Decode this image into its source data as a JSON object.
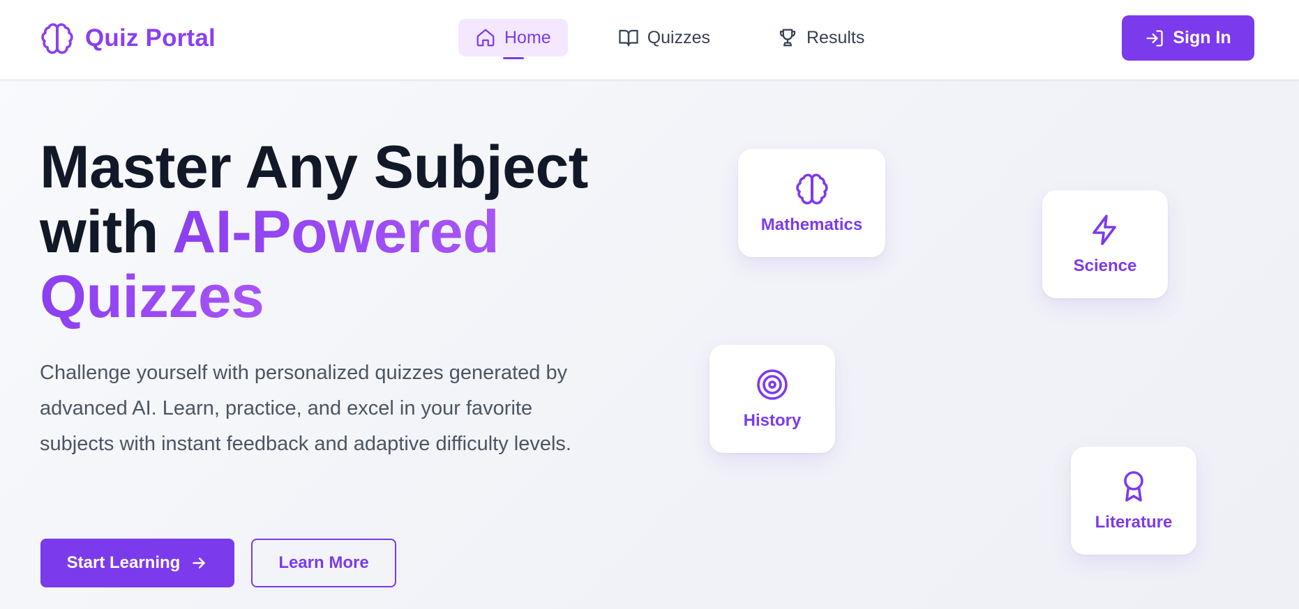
{
  "header": {
    "brand": "Quiz Portal",
    "nav": [
      {
        "label": "Home",
        "icon": "home-icon",
        "active": true
      },
      {
        "label": "Quizzes",
        "icon": "book-open-icon",
        "active": false
      },
      {
        "label": "Results",
        "icon": "trophy-icon",
        "active": false
      }
    ],
    "signin_label": "Sign In"
  },
  "hero": {
    "title_line1": "Master Any Subject",
    "title_with": "with ",
    "title_accent1": "AI-Powered",
    "title_accent2": "Quizzes",
    "description": "Challenge yourself with personalized quizzes generated by advanced AI. Learn, practice, and excel in your favorite subjects with instant feedback and adaptive difficulty levels.",
    "primary_button": "Start Learning",
    "secondary_button": "Learn More"
  },
  "subjects": [
    {
      "label": "Mathematics",
      "icon": "brain-icon"
    },
    {
      "label": "Science",
      "icon": "lightning-icon"
    },
    {
      "label": "History",
      "icon": "target-icon"
    },
    {
      "label": "Literature",
      "icon": "award-icon"
    }
  ],
  "colors": {
    "accent": "#7c3aed",
    "accent_light": "#f3e8ff",
    "heading": "#111827",
    "body_text": "#4b5563"
  }
}
